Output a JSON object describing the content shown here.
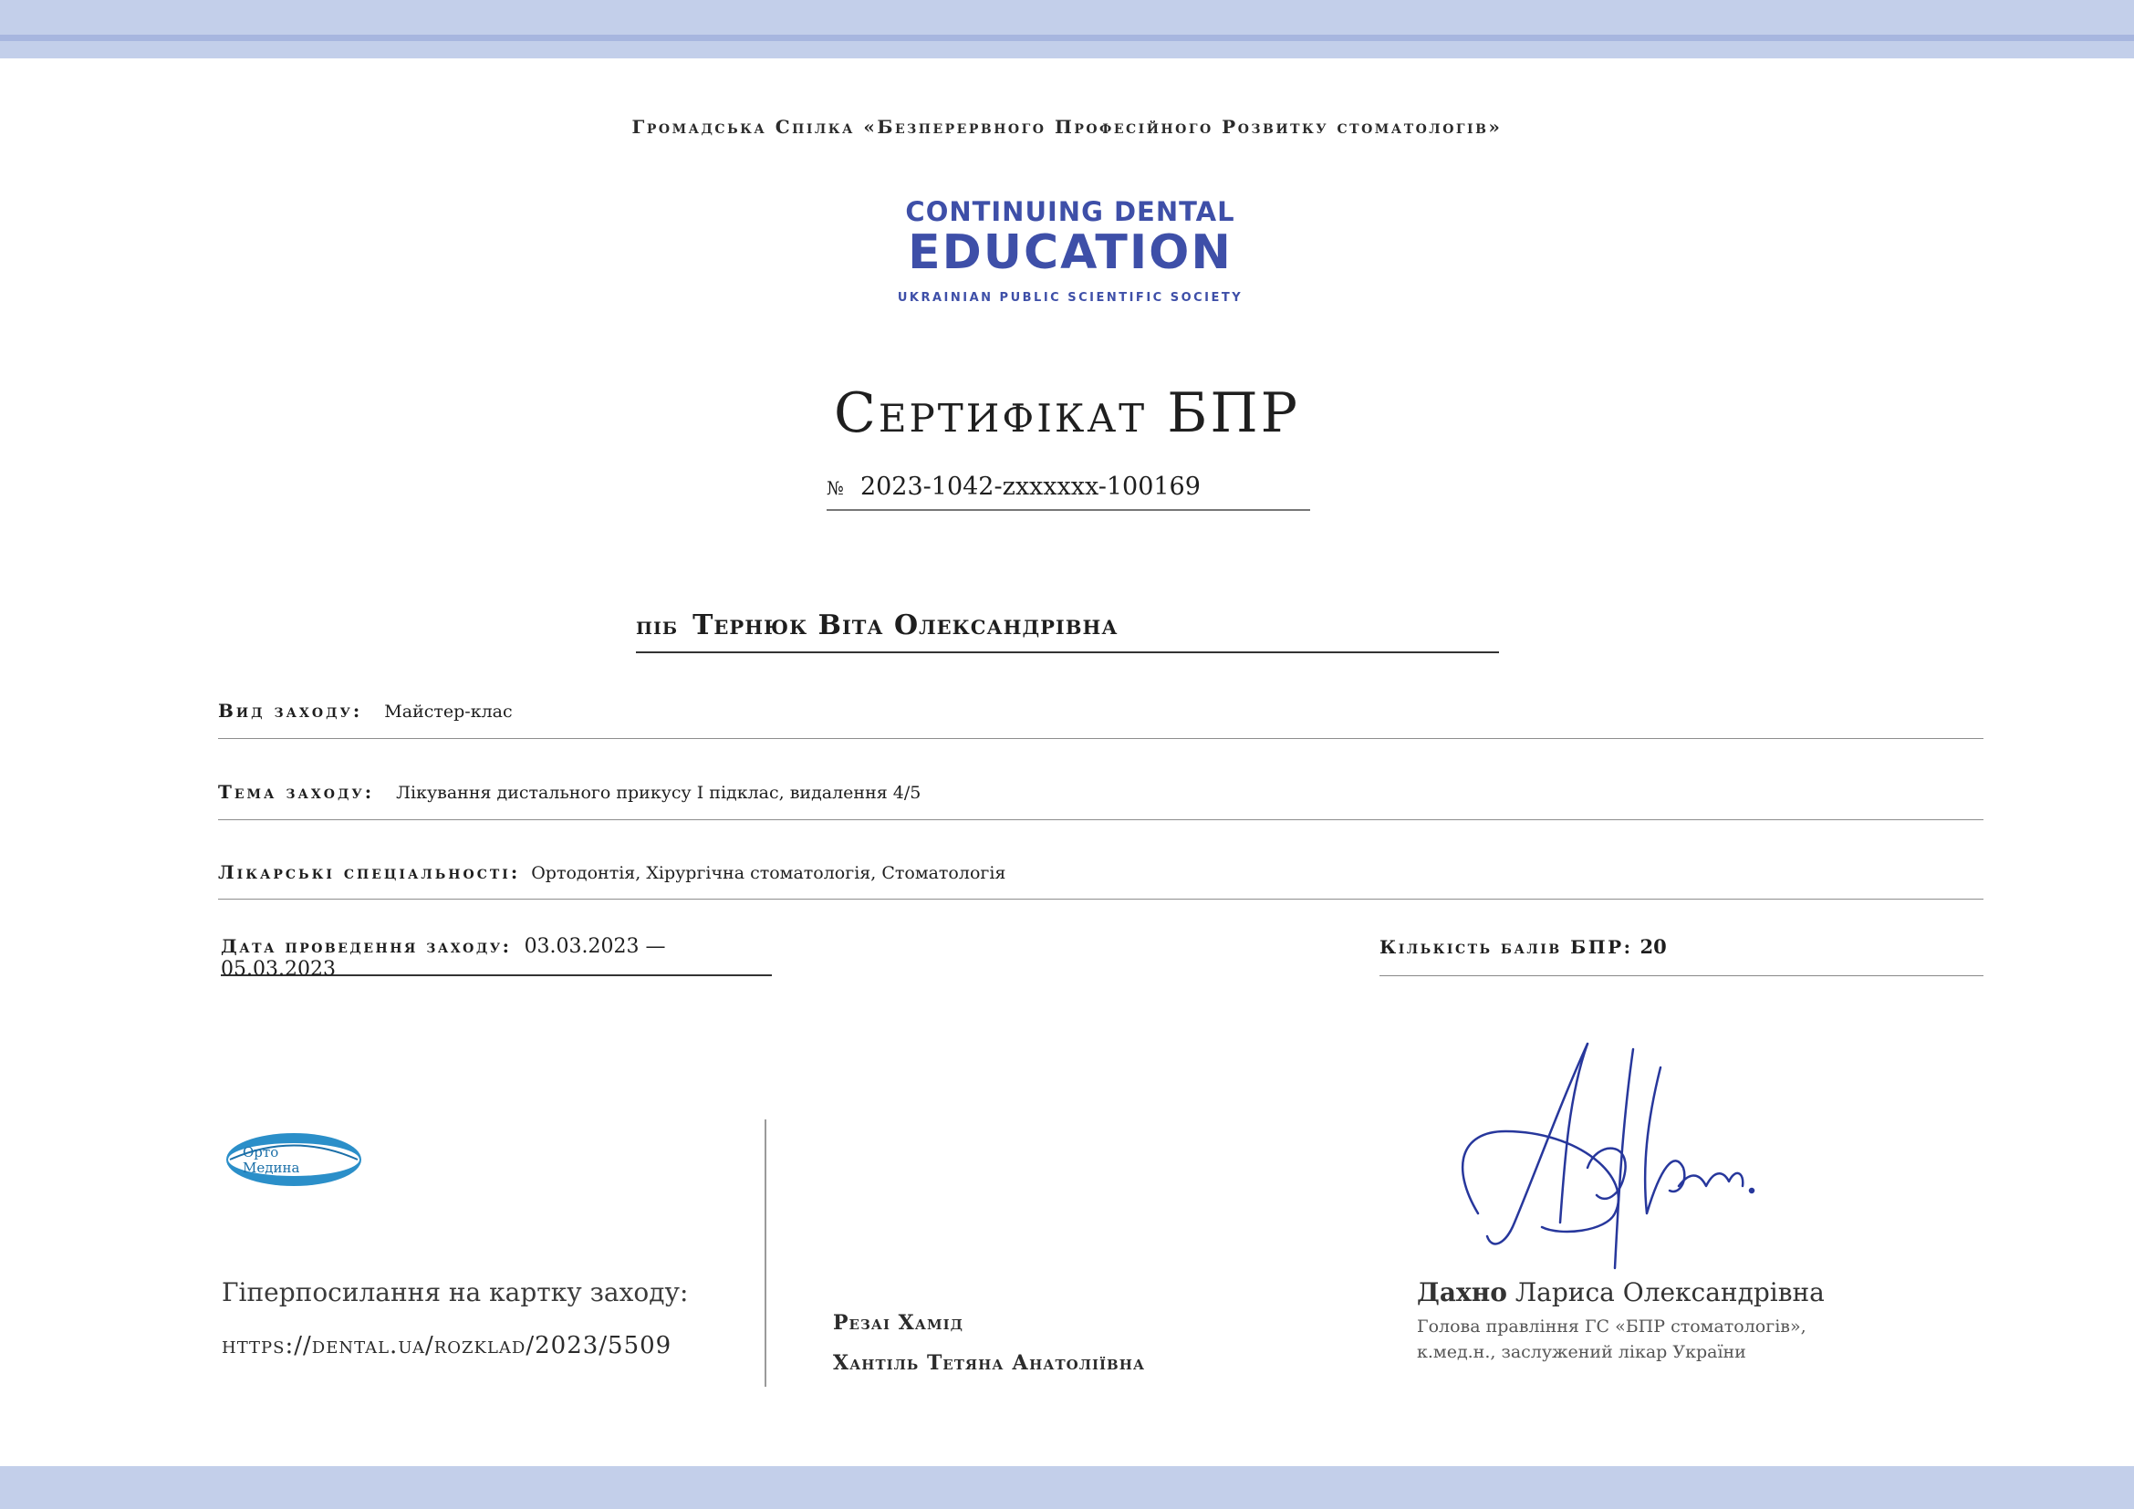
{
  "org_name": "Громадська Спілка «Безперервного Професійного Розвитку стоматологів»",
  "logo": {
    "line1": "CONTINUING DENTAL",
    "line2": "EDUCATION",
    "line3": "UKRAINIAN PUBLIC SCIENTIFIC SOCIETY",
    "color": "#3e4fa8"
  },
  "title": "Сертифікат БПР",
  "number": {
    "sign": "№",
    "value": "2023-1042-zxxxxxx-100169"
  },
  "recipient": {
    "label": "ПІБ",
    "value": "Тернюк Віта Олександрівна"
  },
  "event_type": {
    "label": "Вид заходу:",
    "value": "Майстер-клас"
  },
  "event_topic": {
    "label": "Тема заходу:",
    "value": "Лікування дистального прикусу I підклас, видалення 4/5"
  },
  "specialties": {
    "label": "Лікарські спеціальності:",
    "value": "Ортодонтія, Хірургічна стоматологія, Стоматологія"
  },
  "event_date": {
    "label": "Дата проведення заходу:",
    "value": "03.03.2023 — 05.03.2023"
  },
  "points": {
    "label": "Кількість балів БПР:",
    "value": "20"
  },
  "partner_logo": {
    "line1": "Орто",
    "line2": "Медина"
  },
  "link": {
    "label": "Гіперпосилання на картку заходу:",
    "url": "https://dental.ua/rozklad/2023/5509"
  },
  "authors": [
    "Резаі Хамід",
    "Хантіль Тетяна Анатоліївна"
  ],
  "head": {
    "surname": "Дахно",
    "given_names": "Лариса Олександрівна",
    "position_line1": "Голова правління ГС «БПР стоматологів»,",
    "position_line2": "к.мед.н., заслужений лікар України"
  },
  "colors": {
    "band": "#c3cfea",
    "band_line": "#a7b6df",
    "signature_ink": "#27379c"
  }
}
